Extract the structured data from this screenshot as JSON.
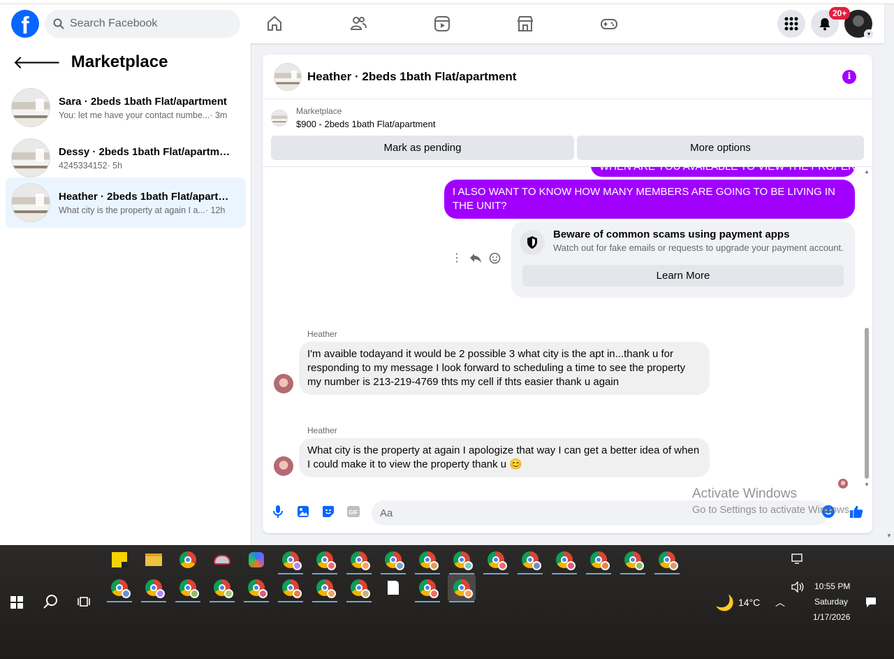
{
  "topbar": {
    "logo": "f",
    "search_placeholder": "Search Facebook",
    "nav_icons": [
      "home-icon",
      "friends-icon",
      "video-icon",
      "marketplace-icon",
      "gaming-icon"
    ],
    "notification_badge": "20+"
  },
  "sidebar": {
    "title": "Marketplace",
    "conversations": [
      {
        "title": "Sara · 2beds 1bath Flat/apartment",
        "snippet": "You: let me have your contact numbe...",
        "time": "· 3m"
      },
      {
        "title": "Dessy · 2beds 1bath Flat/apartment",
        "snippet": "4245334152",
        "time": "· 5h"
      },
      {
        "title": "Heather · 2beds 1bath Flat/apartm...",
        "snippet": "What city is the property at again I a...",
        "time": "· 12h"
      }
    ]
  },
  "chat": {
    "title": "Heather · 2beds 1bath Flat/apartment",
    "listing_label": "Marketplace",
    "listing_price": "$900 - 2beds 1bath Flat/apartment",
    "mark_pending": "Mark as pending",
    "more_options": "More options",
    "outgoing_partial": "WHEN ARE YOU AVAILABLE TO VIEW THE PROPERTY?",
    "outgoing_message": "I ALSO WANT TO KNOW HOW MANY MEMBERS ARE GOING TO BE LIVING IN THE UNIT?",
    "scam_title": "Beware of common scams using payment apps",
    "scam_text": "Watch out for fake emails or requests to upgrade your payment account.",
    "learn_more": "Learn More",
    "incoming": [
      {
        "sender": "Heather",
        "text": "I'm avaible todayand it would be 2 possible 3 what city is the apt in...thank u for responding to my message I look forward to scheduling a time to see the property my number is 213-219-4769 thts my cell if thts easier thank u again"
      },
      {
        "sender": "Heather",
        "text": "What city is the property at again I apologize that way I can get a better idea of when I could make it to view the property thank u 😊"
      }
    ],
    "composer_placeholder": "Aa"
  },
  "watermark": {
    "line1": "Activate Windows",
    "line2": "Go to Settings to activate Windows."
  },
  "taskbar": {
    "weather": "14°C",
    "time": "10:55 PM",
    "day": "Saturday",
    "date": "1/17/2026"
  },
  "colors": {
    "facebook_blue": "#0866ff",
    "message_purple": "#a100ff",
    "notification_red": "#e41e3f"
  }
}
